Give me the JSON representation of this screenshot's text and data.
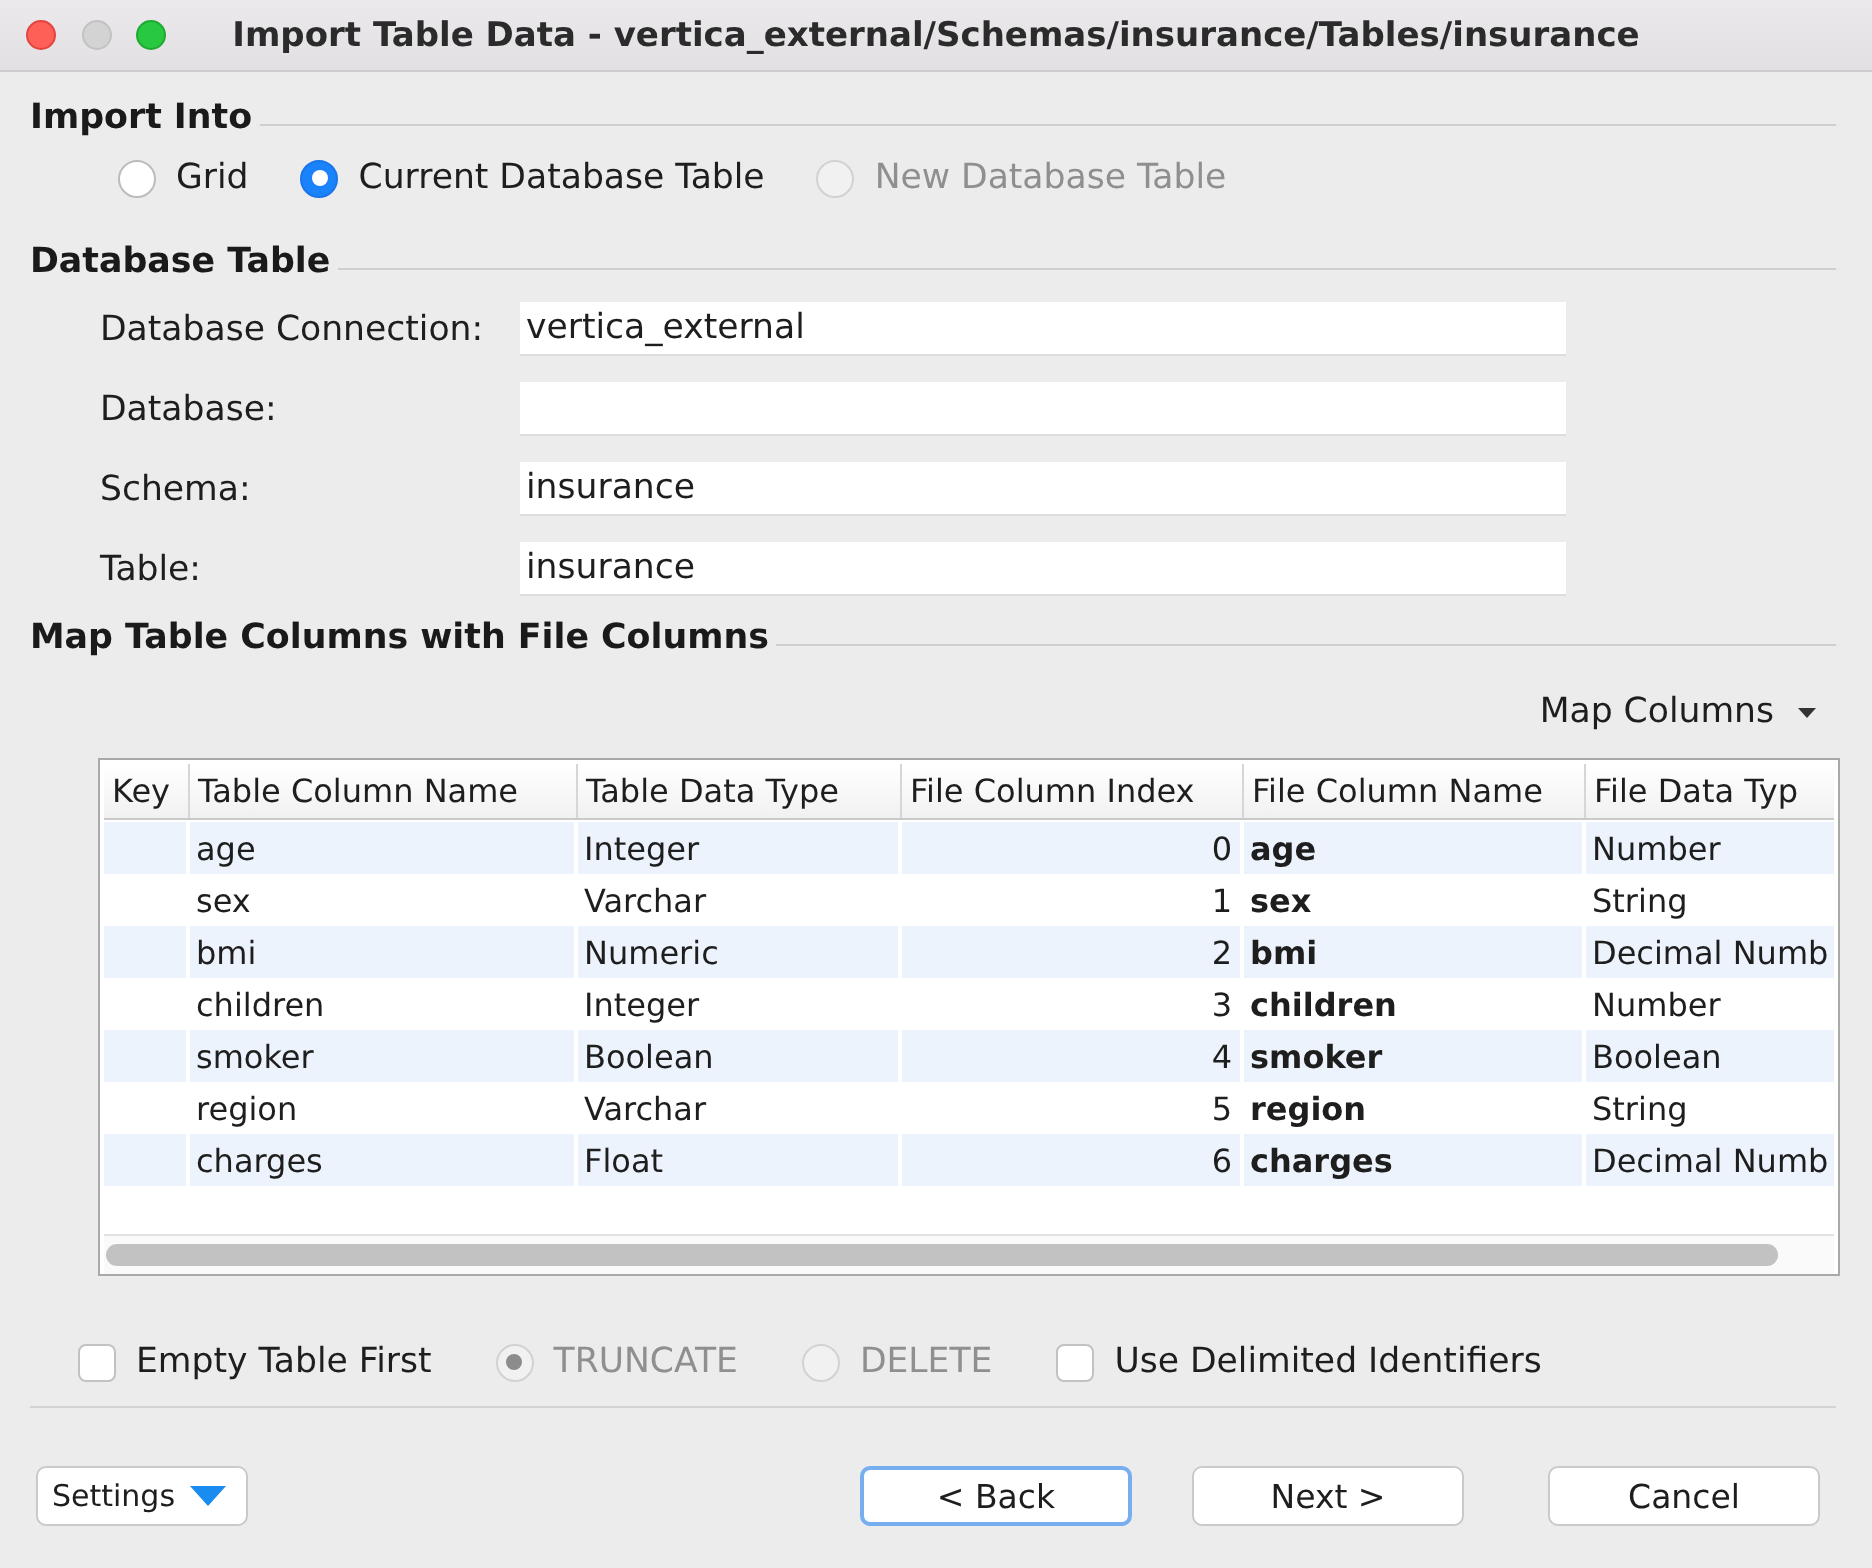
{
  "window": {
    "title": "Import Table Data - vertica_external/Schemas/insurance/Tables/insurance",
    "controls": [
      {
        "kind": "close",
        "disabled": false
      },
      {
        "kind": "minimize",
        "disabled": true
      },
      {
        "kind": "zoom",
        "disabled": false
      }
    ]
  },
  "import_into": {
    "title": "Import Into",
    "options": [
      {
        "label": "Grid",
        "selected": false,
        "disabled": false
      },
      {
        "label": "Current Database Table",
        "selected": true,
        "disabled": false
      },
      {
        "label": "New Database Table",
        "selected": false,
        "disabled": true
      }
    ]
  },
  "database_table": {
    "title": "Database Table",
    "fields": [
      {
        "label": "Database Connection:",
        "value": "vertica_external"
      },
      {
        "label": "Database:"
      },
      {
        "label": "Schema:",
        "value": "insurance"
      },
      {
        "label": "Table:",
        "value": "insurance"
      }
    ]
  },
  "column_mapping": {
    "title": "Map Table Columns with File Columns",
    "menu_button": "Map Columns",
    "table": {
      "columns": [
        "Key",
        "Table Column Name",
        "Table Data Type",
        "File Column Index",
        "File Column Name",
        "File Data Typ"
      ],
      "rows": [
        {
          "table_column_name": "age",
          "table_data_type": "Integer",
          "file_column_index": "0",
          "file_column_name": "age",
          "file_data_type": "Number"
        },
        {
          "table_column_name": "sex",
          "table_data_type": "Varchar",
          "file_column_index": "1",
          "file_column_name": "sex",
          "file_data_type": "String"
        },
        {
          "table_column_name": "bmi",
          "table_data_type": "Numeric",
          "file_column_index": "2",
          "file_column_name": "bmi",
          "file_data_type": "Decimal Numb"
        },
        {
          "table_column_name": "children",
          "table_data_type": "Integer",
          "file_column_index": "3",
          "file_column_name": "children",
          "file_data_type": "Number"
        },
        {
          "table_column_name": "smoker",
          "table_data_type": "Boolean",
          "file_column_index": "4",
          "file_column_name": "smoker",
          "file_data_type": "Boolean"
        },
        {
          "table_column_name": "region",
          "table_data_type": "Varchar",
          "file_column_index": "5",
          "file_column_name": "region",
          "file_data_type": "String"
        },
        {
          "table_column_name": "charges",
          "table_data_type": "Float",
          "file_column_index": "6",
          "file_column_name": "charges",
          "file_data_type": "Decimal Numb"
        }
      ]
    }
  },
  "options": [
    {
      "kind": "checkbox",
      "label": "Empty Table First",
      "checked": false
    },
    {
      "kind": "radio",
      "label": "TRUNCATE",
      "selected": true,
      "disabled": true
    },
    {
      "kind": "radio",
      "label": "DELETE",
      "selected": false,
      "disabled": true
    },
    {
      "kind": "checkbox",
      "label": "Use Delimited Identifiers",
      "checked": false
    }
  ],
  "buttons": {
    "settings": "Settings",
    "navigation": [
      {
        "label": "< Back",
        "focused": true
      },
      {
        "label": "Next >",
        "focused": false
      },
      {
        "label": "Cancel",
        "focused": false
      }
    ]
  }
}
